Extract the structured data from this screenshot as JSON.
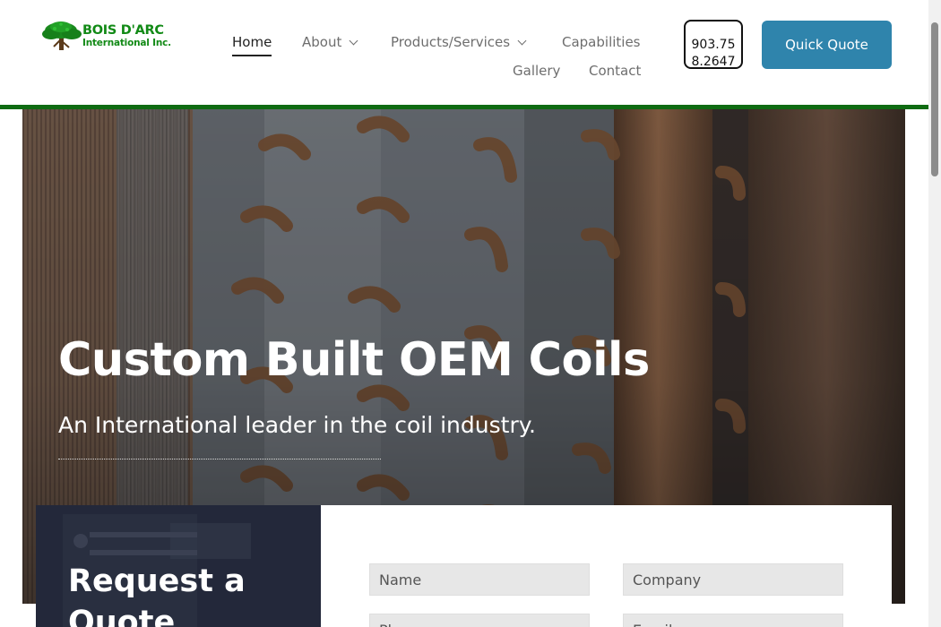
{
  "brand": {
    "line1": "BOIS D'ARC",
    "line2": "International Inc."
  },
  "nav": {
    "home": "Home",
    "about": "About",
    "products": "Products/Services",
    "capabilities": "Capabilities",
    "gallery": "Gallery",
    "contact": "Contact"
  },
  "header": {
    "phone": "903.758.2647",
    "quote_button": "Quick Quote"
  },
  "hero": {
    "title": "Custom Built OEM Coils",
    "subtitle": "An International leader in the coil industry."
  },
  "quote_form": {
    "heading": "Request a Quote",
    "fields": {
      "name": "Name",
      "company": "Company",
      "phone": "Phone",
      "email": "Email"
    }
  },
  "colors": {
    "accent_green": "#0f6b12",
    "logo_green": "#128a16",
    "quote_button_blue": "#2f84ac",
    "form_panel_dark": "#252b3a"
  }
}
